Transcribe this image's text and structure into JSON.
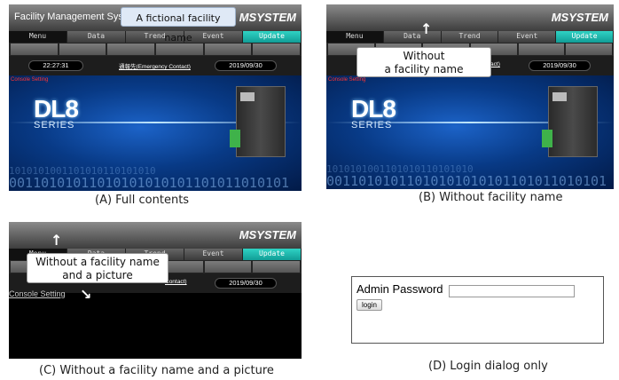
{
  "app": {
    "system_title": "Facility Management System",
    "logo": "MSYSTEM",
    "menu_tabs": [
      "Menu",
      "Data",
      "Trend",
      "Event",
      "Update"
    ],
    "time": "22:27:31",
    "contact": "通報先(Emergency Contact)",
    "contact_partial": "ontact)",
    "contact_partial_c": "Contact)",
    "date": "2019/09/30",
    "console_link": "Console Setting",
    "hero_title": "DL8",
    "hero_subtitle": "SERIES",
    "binary_text": "00110101011010101010101101011010101",
    "binary_small": "1010101001101010110101010"
  },
  "callouts": {
    "facility_name": "A fictional facility name",
    "without_facility_line1": "Without",
    "without_facility_line2": "a facility  name",
    "without_both_line1": "Without a facility name",
    "without_both_line2": "and a picture"
  },
  "captions": {
    "a": "(A) Full contents",
    "b": "(B) Without facility name",
    "c": "(C) Without a facility name and a picture",
    "d": "(D) Login dialog only"
  },
  "login": {
    "label": "Admin Password",
    "password_value": "",
    "button": "login"
  },
  "colors": {
    "update_tab": "#1bb5ab",
    "hero_blue": "#0b4ba8",
    "toolbar_dark": "#3d3d3d"
  }
}
